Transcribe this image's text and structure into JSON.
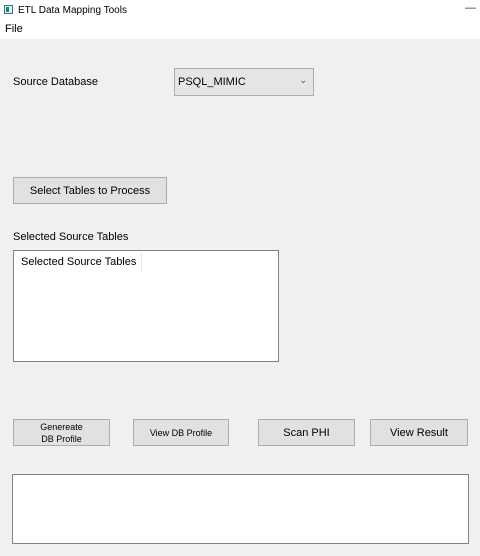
{
  "window": {
    "title": "ETL Data Mapping Tools",
    "minimize_glyph": "—"
  },
  "menu": {
    "file": "File"
  },
  "source_database": {
    "label": "Source Database",
    "selected": "PSQL_MIMIC"
  },
  "buttons": {
    "select_tables": "Select Tables to Process",
    "generate_profile_line1": "Genereate",
    "generate_profile_line2": "DB Profile",
    "view_profile": "View DB Profile",
    "scan_phi": "Scan PHI",
    "view_result": "View Result"
  },
  "selected_tables": {
    "label": "Selected Source Tables",
    "column_header": "Selected Source Tables",
    "rows": []
  },
  "icons": {
    "app": "app-window-icon",
    "dropdown": "chevron-down-icon"
  }
}
